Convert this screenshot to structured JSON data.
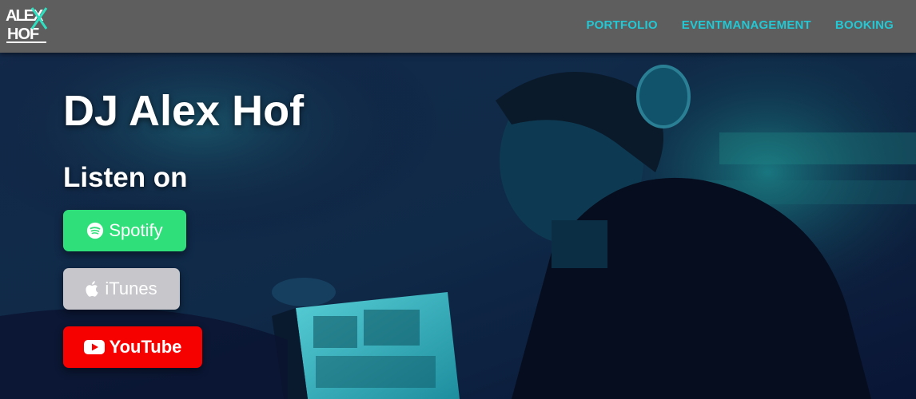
{
  "brand": {
    "logo_line1": "ALEX",
    "logo_line2": "HOF"
  },
  "nav": {
    "items": [
      {
        "label": "PORTFOLIO"
      },
      {
        "label": "EVENTMANAGEMENT"
      },
      {
        "label": "BOOKING"
      }
    ]
  },
  "hero": {
    "title": "DJ Alex Hof",
    "listen_label": "Listen on",
    "buttons": {
      "spotify": "Spotify",
      "itunes": "iTunes",
      "youtube": "YouTube"
    },
    "image_alt": "DJ at laptop with headphones under blue stage light"
  },
  "colors": {
    "navbar_bg": "#5e5e5e",
    "nav_link": "#22c8d4",
    "spotify": "#2fe07a",
    "itunes": "#c6c6cb",
    "youtube": "#f70000"
  },
  "icons": {
    "logo": "alex-hof-logo",
    "spotify": "spotify-icon",
    "itunes": "apple-icon",
    "youtube": "youtube-icon"
  }
}
